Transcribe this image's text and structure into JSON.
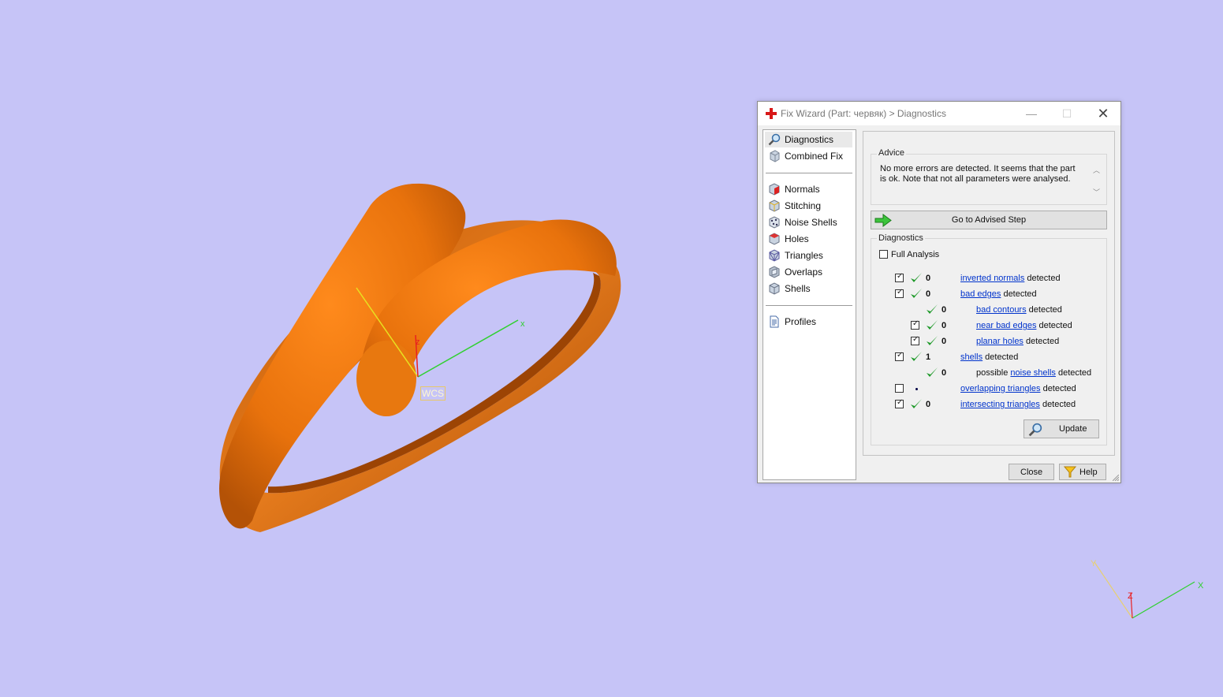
{
  "viewport": {
    "wcs_label": "WCS",
    "axis_labels": {
      "x": "x",
      "z": "z"
    },
    "corner_axes": {
      "x": "X",
      "y": "Y",
      "z": "Z"
    },
    "background": "#c6c4f7",
    "part_color": "#e87d10"
  },
  "dialog": {
    "title": "Fix Wizard (Part: червяк) > Diagnostics",
    "icon": "red-cross-icon",
    "nav": [
      {
        "label": "Diagnostics",
        "icon": "magnifier-icon",
        "selected": true
      },
      {
        "label": "Combined Fix",
        "icon": "cube-icon"
      },
      {
        "label": "Normals",
        "icon": "normals-cube-icon"
      },
      {
        "label": "Stitching",
        "icon": "stitching-cube-icon"
      },
      {
        "label": "Noise Shells",
        "icon": "noise-shells-icon"
      },
      {
        "label": "Holes",
        "icon": "holes-cube-icon"
      },
      {
        "label": "Triangles",
        "icon": "triangles-cube-icon"
      },
      {
        "label": "Overlaps",
        "icon": "overlaps-cube-icon"
      },
      {
        "label": "Shells",
        "icon": "shells-cube-icon"
      },
      {
        "label": "Profiles",
        "icon": "profile-document-icon"
      }
    ],
    "advice": {
      "group_label": "Advice",
      "text_line1": "No more errors are detected. It seems that the part",
      "text_line2": "is ok. Note that not all parameters were analysed."
    },
    "advised_button": "Go to Advised Step",
    "diagnostics": {
      "group_label": "Diagnostics",
      "full_analysis_label": "Full Analysis",
      "full_analysis_checked": false,
      "rows": [
        {
          "checked": true,
          "status": "ok",
          "count": "0",
          "link": "inverted normals",
          "suffix": " detected"
        },
        {
          "checked": true,
          "status": "ok",
          "count": "0",
          "link": "bad edges",
          "suffix": " detected"
        },
        {
          "checked": null,
          "status": "ok",
          "count": "0",
          "link": "bad contours",
          "suffix": " detected"
        },
        {
          "checked": true,
          "status": "ok",
          "count": "0",
          "link": "near bad edges",
          "suffix": " detected"
        },
        {
          "checked": true,
          "status": "ok",
          "count": "0",
          "link": "planar holes",
          "suffix": " detected"
        },
        {
          "checked": true,
          "status": "ok",
          "count": "1",
          "link": "shells",
          "suffix": " detected"
        },
        {
          "checked": null,
          "status": "ok",
          "count": "0",
          "prefix": "possible ",
          "link": "noise shells",
          "suffix": " detected"
        },
        {
          "checked": false,
          "status": "unknown",
          "count": "",
          "link": "overlapping triangles",
          "suffix": " detected"
        },
        {
          "checked": true,
          "status": "ok",
          "count": "0",
          "link": "intersecting triangles",
          "suffix": " detected"
        }
      ]
    },
    "update_button": "Update",
    "close_button": "Close",
    "help_button": "Help"
  }
}
